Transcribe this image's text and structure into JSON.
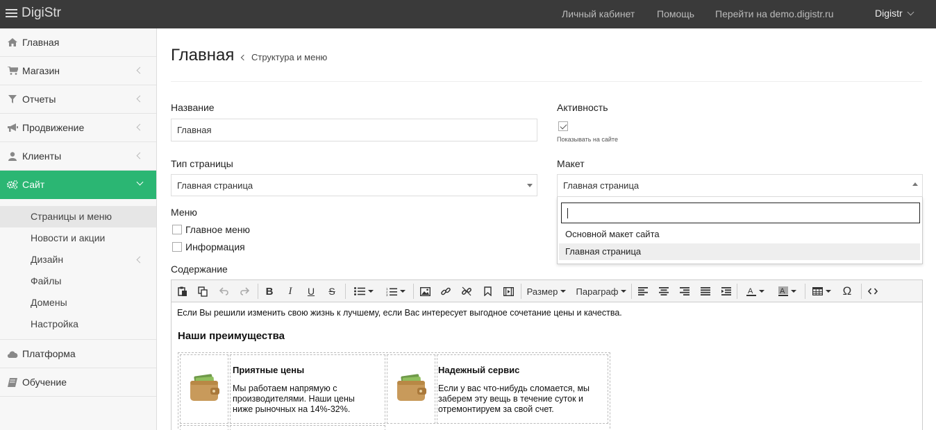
{
  "brand": {
    "name": "DigiStr"
  },
  "topnav": {
    "items": [
      "Личный кабинет",
      "Помощь",
      "Перейти на demo.digistr.ru"
    ],
    "user": "Digistr"
  },
  "sidebar": {
    "items": [
      {
        "label": "Главная",
        "icon": "home-icon"
      },
      {
        "label": "Магазин",
        "icon": "cart-icon"
      },
      {
        "label": "Отчеты",
        "icon": "filter-icon"
      },
      {
        "label": "Продвижение",
        "icon": "bullhorn-icon"
      },
      {
        "label": "Клиенты",
        "icon": "user-icon"
      },
      {
        "label": "Сайт",
        "icon": "gears-icon"
      }
    ],
    "sub_items": [
      "Страницы и меню",
      "Новости и акции",
      "Дизайн",
      "Файлы",
      "Домены",
      "Настройка"
    ],
    "bottom_items": [
      {
        "label": "Платформа",
        "icon": "cloud-icon"
      },
      {
        "label": "Обучение",
        "icon": "book-icon"
      }
    ]
  },
  "page": {
    "title": "Главная",
    "breadcrumb": "Структура и меню"
  },
  "form": {
    "name_label": "Название",
    "name_value": "Главная",
    "active_label": "Активность",
    "active_caption": "Показывать на сайте",
    "type_label": "Тип страницы",
    "type_value": "Главная страница",
    "layout_label": "Макет",
    "layout_value": "Главная страница",
    "layout_options": [
      "Основной макет сайта",
      "Главная страница"
    ],
    "menu_label": "Меню",
    "menu_options": [
      "Главное меню",
      "Информация"
    ],
    "content_label": "Содержание"
  },
  "editor": {
    "toolbar": {
      "size": "Размер",
      "paragraph": "Параграф"
    },
    "intro": "Если Вы решили изменить свою жизнь к лучшему, если Вас интересует выгодное сочетание цены и качества.",
    "heading": "Наши преимущества",
    "features": [
      {
        "title": "Приятные цены",
        "lines": [
          "Мы работаем напрямую с",
          "производителями. Наши цены",
          "ниже рыночных на 14%-32%."
        ]
      },
      {
        "title": "Надежный сервис",
        "lines": [
          "Если у вас что-нибудь сломается, мы",
          "заберем эту вещь в течение суток и",
          "отремонтируем за свой счет."
        ]
      }
    ]
  },
  "colors": {
    "accent": "#2bb673",
    "topbar": "#3a3a3a"
  }
}
